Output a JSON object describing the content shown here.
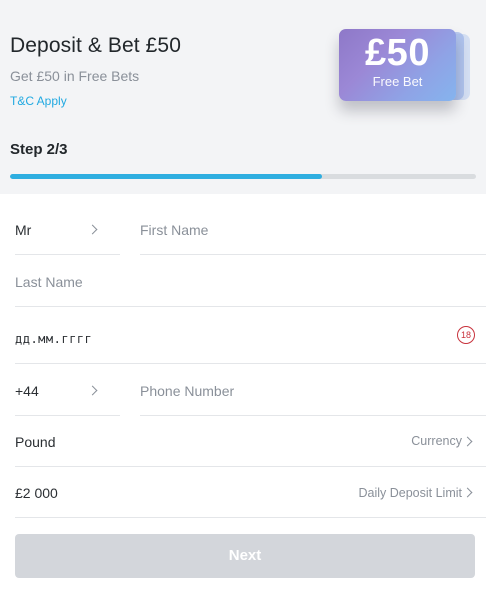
{
  "header": {
    "title": "Deposit & Bet £50",
    "subtitle": "Get £50 in Free Bets",
    "tc_link": "T&C Apply",
    "promo_card": {
      "amount": "£50",
      "label": "Free Bet"
    }
  },
  "progress": {
    "step_label": "Step 2/3",
    "fraction": 0.67,
    "fill_color": "#2eaee0"
  },
  "form": {
    "title_select": {
      "value": "Mr",
      "icon": "chevron-right-icon"
    },
    "first_name": {
      "placeholder": "First Name"
    },
    "last_name": {
      "placeholder": "Last Name"
    },
    "date_of_birth": {
      "placeholder": "дд.мм.гггг",
      "age_badge": "18"
    },
    "dial_code": {
      "value": "+44",
      "icon": "chevron-right-icon"
    },
    "phone": {
      "placeholder": "Phone Number"
    },
    "currency": {
      "value": "Pound",
      "label": "Currency"
    },
    "deposit_limit": {
      "value": "£2 000",
      "label": "Daily Deposit Limit"
    }
  },
  "next_button": {
    "label": "Next"
  }
}
